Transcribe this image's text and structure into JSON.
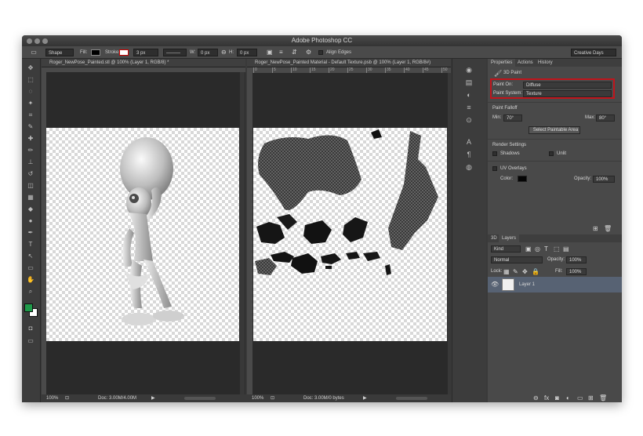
{
  "app": {
    "title": "Adobe Photoshop CC",
    "workspace": "Creative Days"
  },
  "options": {
    "shape_mode": "Shape",
    "fill_label": "Fill:",
    "stroke_label": "Stroke:",
    "stroke_width": "3 px",
    "w_label": "W:",
    "w_value": "0 px",
    "h_label": "H:",
    "h_value": "0 px",
    "align_edges": "Align Edges"
  },
  "colors": {
    "highlight": "#c0151c",
    "foreground": "#1f9a4a",
    "background_swatch": "#ffffff",
    "layer_selected": "#576273"
  },
  "doc1": {
    "tab": "Roger_NewPose_Painted.stl @ 100% (Layer 1, RGB/8) *",
    "zoom": "100%",
    "doc_info": "Doc: 3.00M/4.00M"
  },
  "doc2": {
    "tab": "Roger_NewPose_Painted Material - Default Texture.psb @ 100% (Layer 1, RGB/8#)",
    "zoom": "100%",
    "doc_info": "Doc: 3.00M/0 bytes",
    "ruler": [
      "0",
      "5",
      "10",
      "15",
      "20",
      "25",
      "30",
      "35",
      "40",
      "45",
      "50"
    ]
  },
  "properties": {
    "tabs": [
      "Properties",
      "Actions",
      "History"
    ],
    "section": "3D Paint",
    "paint_on_label": "Paint On:",
    "paint_on_value": "Diffuse",
    "paint_system_label": "Paint System:",
    "paint_system_value": "Texture",
    "falloff_title": "Paint Falloff",
    "min_label": "Min:",
    "min_value": "70°",
    "max_label": "Max:",
    "max_value": "80°",
    "select_button": "Select Paintable Area",
    "render_title": "Render Settings",
    "shadows": "Shadows",
    "unlit": "Unlit",
    "uv_overlays": "UV Overlays",
    "color_label": "Color:",
    "opacity_label": "Opacity:",
    "opacity_value": "100%"
  },
  "layers": {
    "tabs": [
      "3D",
      "Layers"
    ],
    "kind": "Kind",
    "blend": "Normal",
    "opacity_label": "Opacity:",
    "opacity_value": "100%",
    "lock_label": "Lock:",
    "fill_label": "Fill:",
    "fill_value": "100%",
    "layer_name": "Layer 1"
  },
  "toolbar": {
    "tools": [
      "move-tool",
      "marquee-tool",
      "lasso-tool",
      "quick-select-tool",
      "crop-tool",
      "eyedropper-tool",
      "healing-tool",
      "brush-tool",
      "clone-stamp-tool",
      "history-brush-tool",
      "eraser-tool",
      "gradient-tool",
      "blur-tool",
      "dodge-tool",
      "pen-tool",
      "type-tool",
      "path-select-tool",
      "rectangle-tool",
      "hand-tool",
      "zoom-tool"
    ]
  },
  "icons": {
    "tools": [
      "✥",
      "⬚",
      "◌",
      "✦",
      "⌗",
      "✎",
      "✚",
      "✏",
      "⊥",
      "↺",
      "◫",
      "▦",
      "◆",
      "●",
      "✒",
      "T",
      "↖",
      "▭",
      "✋",
      "⌕"
    ],
    "strip": [
      "◉",
      "▤",
      "◐",
      "≡",
      "⊙",
      "A",
      "¶",
      "◍"
    ]
  }
}
